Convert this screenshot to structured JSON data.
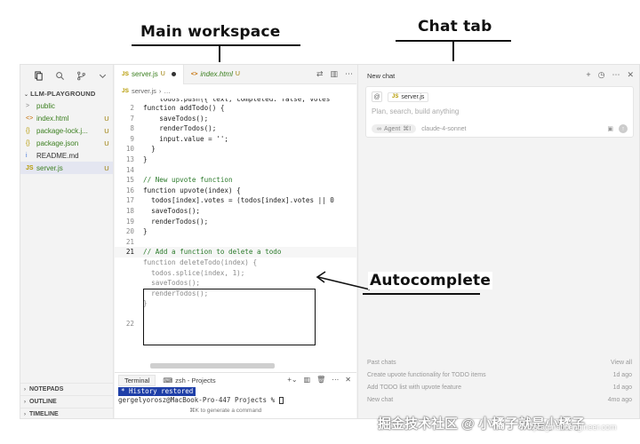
{
  "annotations": {
    "main_workspace": "Main workspace",
    "chat_tab": "Chat tab",
    "autocomplete": "Autocomplete"
  },
  "sidebar": {
    "icons": [
      "files-icon",
      "search-icon",
      "source-control-icon",
      "chevron-down-icon"
    ],
    "project_title": "LLM-PLAYGROUND",
    "files": [
      {
        "name": "public",
        "icon": ">",
        "badge": "",
        "color": "#3b7f1f"
      },
      {
        "name": "index.html",
        "icon": "<>",
        "badge": "U",
        "color": "#3b7f1f"
      },
      {
        "name": "package-lock.j...",
        "icon": "{}",
        "badge": "U",
        "color": "#3b7f1f"
      },
      {
        "name": "package.json",
        "icon": "{}",
        "badge": "U",
        "color": "#3b7f1f"
      },
      {
        "name": "README.md",
        "icon": "i",
        "badge": "",
        "color": "#333333"
      },
      {
        "name": "server.js",
        "icon": "JS",
        "badge": "U",
        "color": "#3b7f1f"
      }
    ],
    "sections": [
      "NOTEPADS",
      "OUTLINE",
      "TIMELINE"
    ]
  },
  "editor": {
    "tabs": [
      {
        "ext": "JS",
        "label": "server.js",
        "badge": "U",
        "modified": true
      },
      {
        "ext": "<>",
        "label": "index.html",
        "badge": "U",
        "modified": false
      }
    ],
    "breadcrumb": "server.js",
    "breadcrumb_more": "…",
    "code": [
      {
        "ln": "2",
        "text": "function addTodo() {"
      },
      {
        "ln": "7",
        "text": "    saveTodos();"
      },
      {
        "ln": "8",
        "text": "    renderTodos();"
      },
      {
        "ln": "9",
        "text": "    input.value = '';"
      },
      {
        "ln": "10",
        "text": "  }"
      },
      {
        "ln": "13",
        "text": "}"
      },
      {
        "ln": "14",
        "text": ""
      },
      {
        "ln": "15",
        "text": "// New upvote function"
      },
      {
        "ln": "16",
        "text": "function upvote(index) {"
      },
      {
        "ln": "17",
        "text": "  todos[index].votes = (todos[index].votes || 0"
      },
      {
        "ln": "18",
        "text": "  saveTodos();"
      },
      {
        "ln": "19",
        "text": "  renderTodos();"
      },
      {
        "ln": "20",
        "text": "}"
      },
      {
        "ln": "21",
        "text": ""
      },
      {
        "ln": "21",
        "text": "// Add a function to delete a todo"
      }
    ],
    "partial_line": "    todos.push({ text, completed: false, votes",
    "autocomplete": [
      "function deleteTodo(index) {",
      "  todos.splice(index, 1);",
      "  saveTodos();",
      "  renderTodos();",
      "}"
    ],
    "last_ln": "22"
  },
  "terminal": {
    "tab": "Terminal",
    "shell": "zsh - Projects",
    "history": "* History restored",
    "prompt": "gergelyorosz@MacBook-Pro-447 Projects % ",
    "hint": "⌘K to generate a command"
  },
  "chat": {
    "title": "New chat",
    "context_file": "server.js",
    "placeholder": "Plan, search, build anything",
    "agent_label": "Agent",
    "agent_shortcut": "⌘I",
    "model": "claude-4-sonnet",
    "past_title": "Past chats",
    "view_all": "View all",
    "past": [
      {
        "title": "Create upvote functionality for TODO items",
        "age": "1d ago"
      },
      {
        "title": "Add TODO list with upvote feature",
        "age": "1d ago"
      },
      {
        "title": "New chat",
        "age": "4mo ago"
      }
    ]
  },
  "watermark": {
    "main": "掘金技术社区 @ 小橘子就是小橘子",
    "url": "pragmaticengineer.com"
  }
}
